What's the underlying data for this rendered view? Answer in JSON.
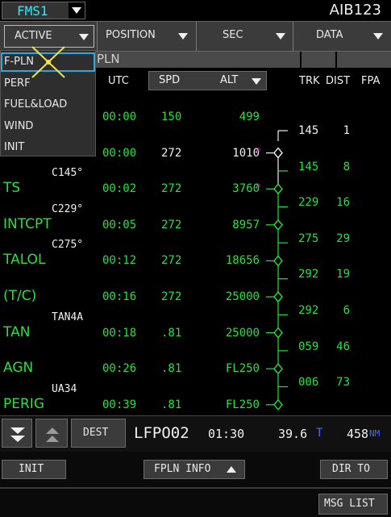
{
  "header": {
    "fms": "FMS1",
    "callsign": "AIB123"
  },
  "tabs": [
    {
      "label": "ACTIVE"
    },
    {
      "label": "POSITION"
    },
    {
      "label": "SEC"
    },
    {
      "label": "DATA"
    }
  ],
  "subtitle": "PLN",
  "dropdown": {
    "items": [
      "F-PLN",
      "PERF",
      "FUEL&LOAD",
      "WIND",
      "INIT"
    ]
  },
  "columns": {
    "utc": "UTC",
    "spd": "SPD",
    "alt": "ALT",
    "trk": "TRK",
    "dist": "DIST",
    "fpa": "FPA"
  },
  "rows": [
    {
      "name": "",
      "constraint": "",
      "utc": "00:00",
      "spd": "150",
      "alt": "499",
      "alt_color": "green",
      "star": false
    },
    {
      "name": "",
      "constraint": "",
      "utc": "00:00",
      "spd": "272",
      "alt": "1010",
      "alt_color": "white",
      "star": true
    },
    {
      "name": "TS",
      "constraint": "C145°",
      "utc": "00:02",
      "spd": "272",
      "alt": "3760",
      "alt_color": "green",
      "star": true
    },
    {
      "name": "INTCPT",
      "constraint": "C229°",
      "utc": "00:05",
      "spd": "272",
      "alt": "8957",
      "alt_color": "green",
      "star": false
    },
    {
      "name": "TALOL",
      "constraint": "C275°",
      "utc": "00:12",
      "spd": "272",
      "alt": "18656",
      "alt_color": "green",
      "star": false
    },
    {
      "name": "(T/C)",
      "constraint": "",
      "utc": "00:16",
      "spd": "272",
      "alt": "25000",
      "alt_color": "green",
      "star": false
    },
    {
      "name": "TAN",
      "constraint": "TAN4A",
      "utc": "00:18",
      "spd": ".81",
      "alt": "25000",
      "alt_color": "green",
      "star": false
    },
    {
      "name": "AGN",
      "constraint": "",
      "utc": "00:26",
      "spd": ".81",
      "alt": "FL250",
      "alt_color": "green",
      "star": false
    },
    {
      "name": "PERIG",
      "constraint": "UA34",
      "utc": "00:39",
      "spd": ".81",
      "alt": "FL250",
      "alt_color": "green",
      "star": false
    }
  ],
  "legs": [
    {
      "trk": "145",
      "dist": "1",
      "trk_color": "white",
      "dist_color": "white"
    },
    {
      "trk": "145",
      "dist": "8",
      "trk_color": "green",
      "dist_color": "green"
    },
    {
      "trk": "229",
      "dist": "16",
      "trk_color": "green",
      "dist_color": "green"
    },
    {
      "trk": "275",
      "dist": "29",
      "trk_color": "green",
      "dist_color": "green"
    },
    {
      "trk": "292",
      "dist": "19",
      "trk_color": "green",
      "dist_color": "green"
    },
    {
      "trk": "292",
      "dist": "6",
      "trk_color": "green",
      "dist_color": "green"
    },
    {
      "trk": "059",
      "dist": "46",
      "trk_color": "green",
      "dist_color": "green"
    },
    {
      "trk": "006",
      "dist": "73",
      "trk_color": "green",
      "dist_color": "green"
    }
  ],
  "dest_bar": {
    "dest_button": "DEST",
    "airport": "LFPO02",
    "time": "01:30",
    "efob": "39.6",
    "efob_unit": "T",
    "dist": "458",
    "dist_unit": "NM"
  },
  "bottom": {
    "init": "INIT",
    "fpln_info": "FPLN INFO",
    "dir_to": "DIR TO",
    "msg_list": "MSG LIST"
  }
}
